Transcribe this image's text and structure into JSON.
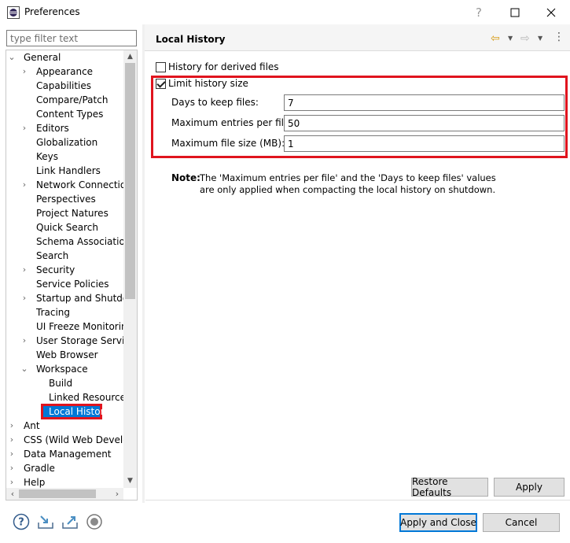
{
  "window": {
    "title": "Preferences"
  },
  "filter": {
    "placeholder": "type filter text"
  },
  "tree": [
    {
      "label": "General",
      "level": 0,
      "expanded": true
    },
    {
      "label": "Appearance",
      "level": 1,
      "twisty": true
    },
    {
      "label": "Capabilities",
      "level": 1
    },
    {
      "label": "Compare/Patch",
      "level": 1
    },
    {
      "label": "Content Types",
      "level": 1
    },
    {
      "label": "Editors",
      "level": 1,
      "twisty": true
    },
    {
      "label": "Globalization",
      "level": 1
    },
    {
      "label": "Keys",
      "level": 1
    },
    {
      "label": "Link Handlers",
      "level": 1
    },
    {
      "label": "Network Connection",
      "level": 1,
      "twisty": true
    },
    {
      "label": "Perspectives",
      "level": 1
    },
    {
      "label": "Project Natures",
      "level": 1
    },
    {
      "label": "Quick Search",
      "level": 1
    },
    {
      "label": "Schema Associations",
      "level": 1
    },
    {
      "label": "Search",
      "level": 1
    },
    {
      "label": "Security",
      "level": 1,
      "twisty": true
    },
    {
      "label": "Service Policies",
      "level": 1
    },
    {
      "label": "Startup and Shutdow",
      "level": 1,
      "twisty": true
    },
    {
      "label": "Tracing",
      "level": 1
    },
    {
      "label": "UI Freeze Monitoring",
      "level": 1
    },
    {
      "label": "User Storage Service",
      "level": 1,
      "twisty": true
    },
    {
      "label": "Web Browser",
      "level": 1
    },
    {
      "label": "Workspace",
      "level": 1,
      "expanded": true
    },
    {
      "label": "Build",
      "level": 2
    },
    {
      "label": "Linked Resources",
      "level": 2
    },
    {
      "label": "Local History",
      "level": 2,
      "selected": true
    },
    {
      "label": "Ant",
      "level": 0,
      "twisty": true
    },
    {
      "label": "CSS (Wild Web Develop",
      "level": 0,
      "twisty": true
    },
    {
      "label": "Data Management",
      "level": 0,
      "twisty": true
    },
    {
      "label": "Gradle",
      "level": 0,
      "twisty": true
    },
    {
      "label": "Help",
      "level": 0,
      "twisty": true
    }
  ],
  "page": {
    "title": "Local History",
    "derived_files_label": "History for derived files",
    "derived_files_checked": false,
    "limit_label": "Limit history size",
    "limit_checked": true,
    "days_label": "Days to keep files:",
    "days_value": "7",
    "entries_label": "Maximum entries per file:",
    "entries_value": "50",
    "filesize_label": "Maximum file size (MB):",
    "filesize_value": "1",
    "note_label": "Note:",
    "note_line1": "The 'Maximum entries per file' and the 'Days to keep files' values",
    "note_line2": "are only applied when compacting the local history on shutdown.",
    "restore_label": "Restore Defaults",
    "apply_label": "Apply"
  },
  "footer": {
    "apply_close_label": "Apply and Close",
    "cancel_label": "Cancel"
  },
  "colors": {
    "accent": "#0078d7",
    "highlight": "#e0141e",
    "back_arrow": "#d89a12"
  },
  "icons": [
    "eclipse-logo-icon",
    "maximize-icon",
    "close-icon",
    "back-arrow-icon",
    "forward-arrow-icon",
    "view-menu-icon",
    "help-icon",
    "import-icon",
    "export-icon",
    "record-icon"
  ]
}
